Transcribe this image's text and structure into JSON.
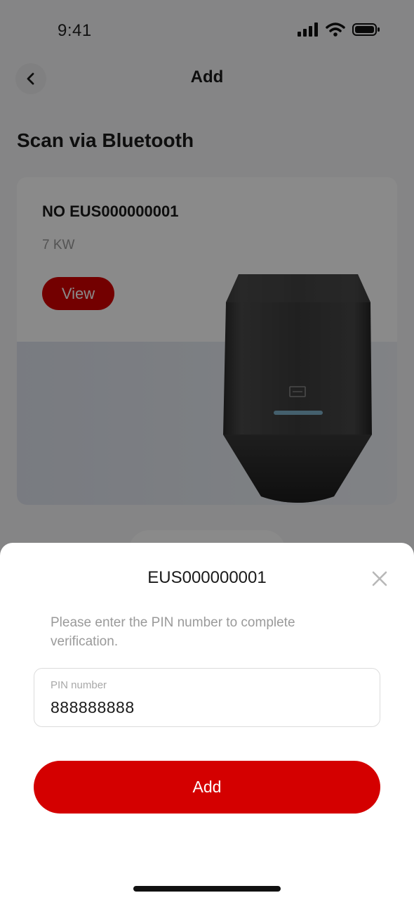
{
  "status_bar": {
    "time": "9:41"
  },
  "nav": {
    "title": "Add"
  },
  "section": {
    "title": "Scan via Bluetooth"
  },
  "device": {
    "name": "NO EUS000000001",
    "power": "7 KW",
    "view_label": "View"
  },
  "dialog": {
    "title": "EUS000000001",
    "hint": "Please enter the PIN number to complete verification.",
    "pin": {
      "label": "PIN number",
      "value": "888888888"
    },
    "add_label": "Add"
  },
  "colors": {
    "accent": "#d40000",
    "overlay": "rgba(0,0,0,0.46)",
    "sheet_bg": "#ffffff",
    "hint_text": "#9a9a9a"
  },
  "icons": [
    "cellular-signal-icon",
    "wifi-icon",
    "battery-icon",
    "chevron-left-icon",
    "close-icon"
  ]
}
